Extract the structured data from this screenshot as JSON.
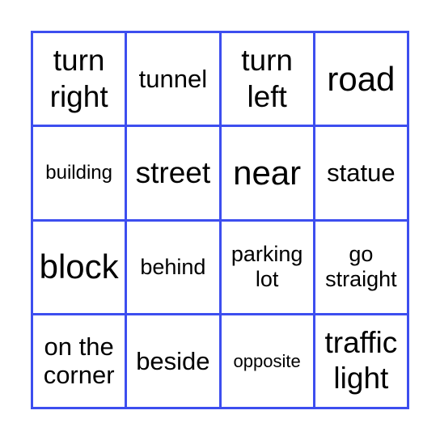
{
  "board": {
    "accent_color": "#3d4eef",
    "cells": [
      {
        "label": "turn\nright",
        "size": "s-l"
      },
      {
        "label": "tunnel",
        "size": "s-m"
      },
      {
        "label": "turn\nleft",
        "size": "s-l"
      },
      {
        "label": "road",
        "size": "s-xl"
      },
      {
        "label": "building",
        "size": "s-xs"
      },
      {
        "label": "street",
        "size": "s-l"
      },
      {
        "label": "near",
        "size": "s-xl"
      },
      {
        "label": "statue",
        "size": "s-m"
      },
      {
        "label": "block",
        "size": "s-xl"
      },
      {
        "label": "behind",
        "size": "s-s"
      },
      {
        "label": "parking\nlot",
        "size": "s-s"
      },
      {
        "label": "go\nstraight",
        "size": "s-s"
      },
      {
        "label": "on the\ncorner",
        "size": "s-m"
      },
      {
        "label": "beside",
        "size": "s-m"
      },
      {
        "label": "opposite",
        "size": "s-xxs"
      },
      {
        "label": "traffic\nlight",
        "size": "s-l"
      }
    ]
  }
}
